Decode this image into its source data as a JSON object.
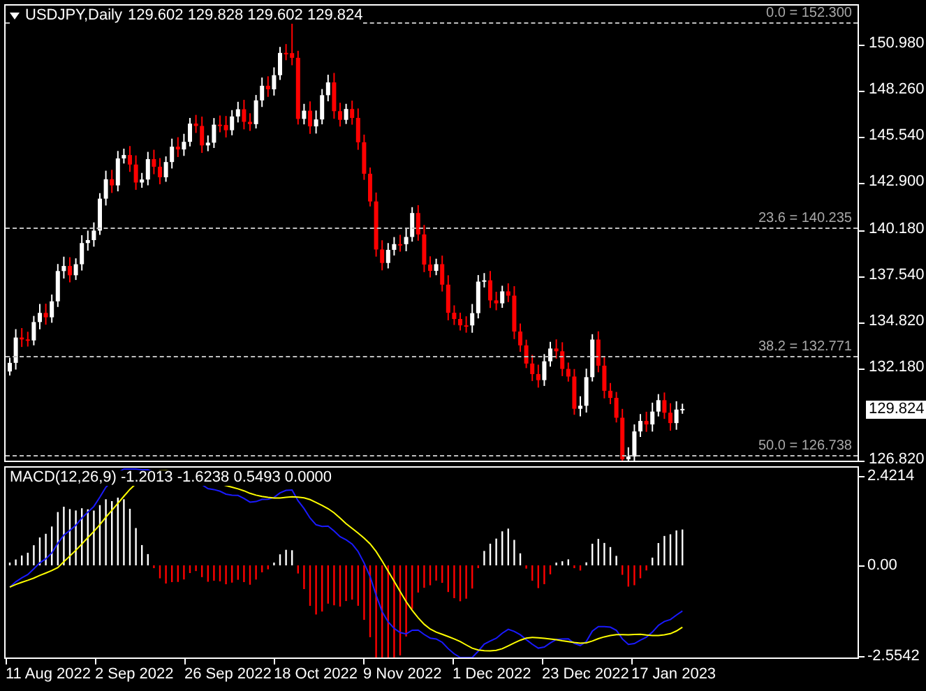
{
  "chart": {
    "symbol": "USDJPY,Daily",
    "ohlc": "129.602 129.828 129.602 129.824",
    "price_ticks": [
      "150.980",
      "148.260",
      "145.540",
      "142.900",
      "140.180",
      "137.540",
      "134.820",
      "132.180",
      "126.820"
    ],
    "current_price": "129.824",
    "fib_levels": [
      {
        "label": "0.0 = 152.300"
      },
      {
        "label": "23.6 = 140.235"
      },
      {
        "label": "38.2 = 132.771"
      },
      {
        "label": "50.0 = 126.738"
      }
    ]
  },
  "macd": {
    "label": "MACD(12,26,9) -1.2013 -1.6238 0.5493 0.0000",
    "ticks": [
      "2.4214",
      "0.00",
      "-2.5542"
    ]
  },
  "date_axis": [
    "11 Aug 2022",
    "2 Sep 2022",
    "26 Sep 2022",
    "18 Oct 2022",
    "9 Nov 2022",
    "1 Dec 2022",
    "23 Dec 2022",
    "17 Jan 2023"
  ]
}
